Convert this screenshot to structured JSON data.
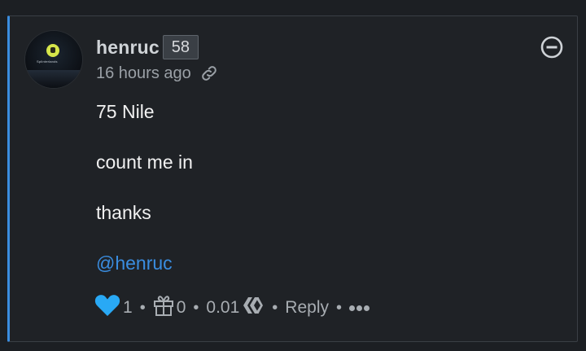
{
  "comment": {
    "author": "henruc",
    "reputation": "58",
    "timestamp": "16 hours ago",
    "avatar_text": "Splinterlands",
    "body_lines": [
      "75 Nile",
      "count me in",
      "thanks"
    ],
    "mention": "@henruc",
    "upvotes": "1",
    "gifts": "0",
    "payout": "0.01",
    "reply_label": "Reply",
    "more_label": "•••",
    "icons": {
      "link": "link-icon",
      "collapse": "minus-circle-icon",
      "upvote": "heart-icon",
      "gift": "gift-icon",
      "currency": "hive-icon"
    },
    "colors": {
      "accent": "#3a8de0",
      "heart": "#29a9f5",
      "background": "#1f2226"
    }
  }
}
